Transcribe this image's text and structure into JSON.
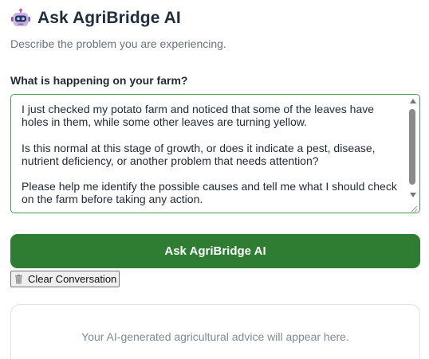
{
  "header": {
    "title": "Ask AgriBridge AI",
    "icon": "robot-icon"
  },
  "subtitle": "Describe the problem you are experiencing.",
  "form": {
    "label": "What is happening on your farm?",
    "problem_text": "I just checked my potato farm and noticed that some of the leaves have holes in them, while some other leaves are turning yellow.\n\nIs this normal at this stage of growth, or does it indicate a pest, disease, nutrient deficiency, or another problem that needs attention?\n\nPlease help me identify the possible causes and tell me what I should check on the farm before taking any action."
  },
  "actions": {
    "ask_label": "Ask AgriBridge AI",
    "clear_label": "Clear Conversation",
    "clear_icon": "trash-icon"
  },
  "response": {
    "placeholder": "Your AI-generated agricultural advice will appear here."
  },
  "colors": {
    "primary_green": "#2e7d32",
    "textarea_border": "#4a9b52",
    "title_text": "#1f2d3d",
    "muted_text": "#6b7280"
  }
}
